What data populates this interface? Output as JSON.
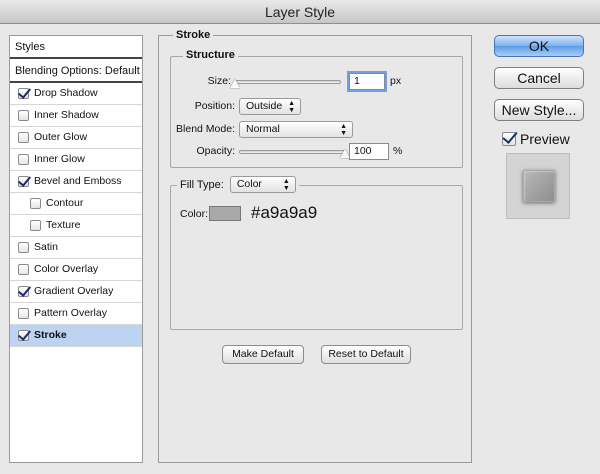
{
  "window": {
    "title": "Layer Style"
  },
  "styles_list": {
    "header": "Styles",
    "blending_options": "Blending Options: Default",
    "items": [
      {
        "label": "Drop Shadow",
        "checked": true,
        "indent": false,
        "selected": false
      },
      {
        "label": "Inner Shadow",
        "checked": false,
        "indent": false,
        "selected": false
      },
      {
        "label": "Outer Glow",
        "checked": false,
        "indent": false,
        "selected": false
      },
      {
        "label": "Inner Glow",
        "checked": false,
        "indent": false,
        "selected": false
      },
      {
        "label": "Bevel and Emboss",
        "checked": true,
        "indent": false,
        "selected": false
      },
      {
        "label": "Contour",
        "checked": false,
        "indent": true,
        "selected": false
      },
      {
        "label": "Texture",
        "checked": false,
        "indent": true,
        "selected": false
      },
      {
        "label": "Satin",
        "checked": false,
        "indent": false,
        "selected": false
      },
      {
        "label": "Color Overlay",
        "checked": false,
        "indent": false,
        "selected": false
      },
      {
        "label": "Gradient Overlay",
        "checked": true,
        "indent": false,
        "selected": false
      },
      {
        "label": "Pattern Overlay",
        "checked": false,
        "indent": false,
        "selected": false
      },
      {
        "label": "Stroke",
        "checked": true,
        "indent": false,
        "selected": true
      }
    ]
  },
  "stroke": {
    "title": "Stroke",
    "structure": {
      "title": "Structure",
      "size_label": "Size:",
      "size_value": "1",
      "size_unit": "px",
      "size_slider_fraction": 0.0,
      "position_label": "Position:",
      "position_value": "Outside",
      "blend_mode_label": "Blend Mode:",
      "blend_mode_value": "Normal",
      "opacity_label": "Opacity:",
      "opacity_value": "100",
      "opacity_unit": "%",
      "opacity_slider_fraction": 1.0
    },
    "fill": {
      "fill_type_label": "Fill Type:",
      "fill_type_value": "Color",
      "color_label": "Color:",
      "color_hex": "#a9a9a9",
      "color_annotation": "#a9a9a9"
    },
    "make_default_label": "Make Default",
    "reset_default_label": "Reset to Default"
  },
  "actions": {
    "ok_label": "OK",
    "cancel_label": "Cancel",
    "new_style_label": "New Style...",
    "preview_label": "Preview",
    "preview_checked": true
  },
  "colors": {
    "selected_row": "#bcd3f2",
    "default_button": "#6fa6ea",
    "stroke_color": "#a9a9a9"
  }
}
